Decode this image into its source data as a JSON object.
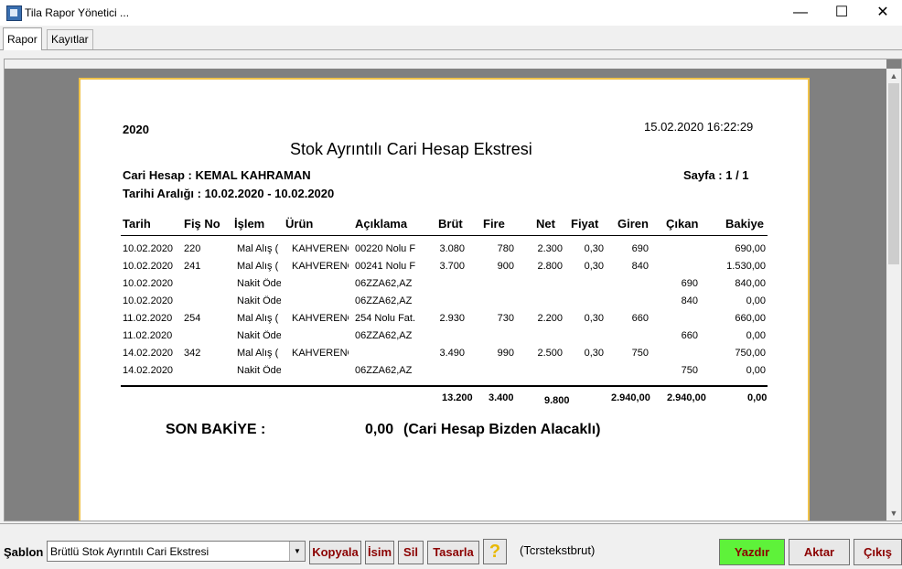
{
  "window": {
    "title": "Tila Rapor Yönetici ...",
    "controls": {
      "minimize": "—",
      "maximize": "☐",
      "close": "✕"
    }
  },
  "tabs": [
    {
      "label": "Rapor",
      "active": true
    },
    {
      "label": "Kayıtlar",
      "active": false
    }
  ],
  "report": {
    "year": "2020",
    "datetime": "15.02.2020 16:22:29",
    "title": "Stok Ayrıntılı Cari Hesap Ekstresi",
    "cari": "Cari Hesap : KEMAL KAHRAMAN",
    "page": "Sayfa : 1 / 1",
    "range": "Tarihi Aralığı : 10.02.2020 - 10.02.2020",
    "headers": [
      "Tarih",
      "Fiş No",
      "İşlem",
      "Ürün",
      "Açıklama",
      "Brüt",
      "Fire",
      "Net",
      "Fiyat",
      "Giren",
      "Çıkan",
      "Bakiye"
    ],
    "rows": [
      [
        "10.02.2020",
        "220",
        "Mal Alış (",
        "KAHVERENG",
        "00220 Nolu F",
        "3.080",
        "780",
        "2.300",
        "0,30",
        "690",
        "",
        "690,00"
      ],
      [
        "10.02.2020",
        "241",
        "Mal Alış (",
        "KAHVERENG",
        "00241 Nolu F",
        "3.700",
        "900",
        "2.800",
        "0,30",
        "840",
        "",
        "1.530,00"
      ],
      [
        "10.02.2020",
        "",
        "Nakit Öde",
        "",
        "06ZZA62,AZ",
        "",
        "",
        "",
        "",
        "",
        "690",
        "840,00"
      ],
      [
        "10.02.2020",
        "",
        "Nakit Öde",
        "",
        "06ZZA62,AZ",
        "",
        "",
        "",
        "",
        "",
        "840",
        "0,00"
      ],
      [
        "11.02.2020",
        "254",
        "Mal Alış (",
        "KAHVERENG",
        "254 Nolu Fat.",
        "2.930",
        "730",
        "2.200",
        "0,30",
        "660",
        "",
        "660,00"
      ],
      [
        "11.02.2020",
        "",
        "Nakit Öde",
        "",
        "06ZZA62,AZ",
        "",
        "",
        "",
        "",
        "",
        "660",
        "0,00"
      ],
      [
        "14.02.2020",
        "342",
        "Mal Alış (",
        "KAHVERENG",
        "",
        "3.490",
        "990",
        "2.500",
        "0,30",
        "750",
        "",
        "750,00"
      ],
      [
        "14.02.2020",
        "",
        "Nakit Öde",
        "",
        "06ZZA62,AZ",
        "",
        "",
        "",
        "",
        "",
        "750",
        "0,00"
      ]
    ],
    "totals": {
      "brut": "13.200",
      "fire": "3.400",
      "net": "9.800",
      "giren": "2.940,00",
      "cikan": "2.940,00",
      "bakiye": "0,00"
    },
    "son_bakiye_label": "SON BAKİYE :",
    "son_bakiye_value": "0,00",
    "son_bakiye_note": "(Cari Hesap Bizden Alacaklı)"
  },
  "bottom": {
    "sablon_label": "Şablon",
    "sablon_value": "Brütlü Stok Ayrıntılı Cari Ekstresi",
    "buttons": {
      "kopyala": "Kopyala",
      "isim": "İsim",
      "sil": "Sil",
      "tasarla": "Tasarla",
      "help": "?",
      "yazdir": "Yazdır",
      "aktar": "Aktar",
      "cikis": "Çıkış"
    },
    "template_code": "(Tcrstekstbrut)"
  },
  "colors": {
    "accent_green": "#5ef23a",
    "button_text": "#8b0000",
    "paper_border": "#f0c24a"
  }
}
